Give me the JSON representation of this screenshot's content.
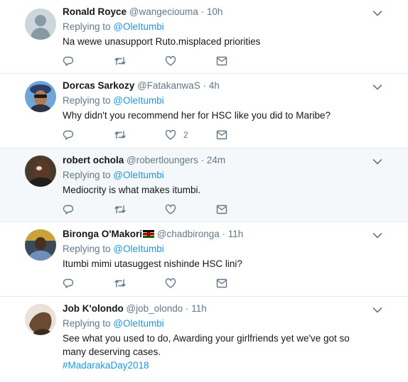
{
  "tweets": [
    {
      "name": "Ronald Royce",
      "handle": "@wangeciouma",
      "dot": "·",
      "time": "10h",
      "replying_prefix": "Replying to ",
      "replying_to": "@OleItumbi",
      "text": "Na wewe unasupport Ruto.misplaced priorities",
      "like_count": ""
    },
    {
      "name": "Dorcas Sarkozy",
      "handle": "@FatakanwaS",
      "dot": "·",
      "time": "4h",
      "replying_prefix": "Replying to ",
      "replying_to": "@OleItumbi",
      "text": "Why didn't you recommend her for HSC like you did to Maribe?",
      "like_count": "2"
    },
    {
      "name": "robert ochola",
      "handle": "@robertloungers",
      "dot": "·",
      "time": "24m",
      "replying_prefix": "Replying to ",
      "replying_to": "@OleItumbi",
      "text": "Mediocrity is what makes itumbi.",
      "like_count": ""
    },
    {
      "name": "Bironga O'Makori",
      "handle": "@chadbironga",
      "dot": "·",
      "time": "11h",
      "replying_prefix": "Replying to ",
      "replying_to": "@OleItumbi",
      "text": "Itumbi mimi utasuggest nishinde HSC lini?",
      "like_count": ""
    },
    {
      "name": "Job K'olondo",
      "handle": "@job_olondo",
      "dot": "·",
      "time": "11h",
      "replying_prefix": "Replying to ",
      "replying_to": "@OleItumbi",
      "text": "See what you used to do, Awarding your girlfriends yet we've got so many deserving cases.",
      "hashtag": "#MadarakaDay2018",
      "like_count": ""
    }
  ],
  "colors": {
    "link": "#1b95e0",
    "muted": "#657786",
    "text": "#14171a",
    "highlight_bg": "#f5f8fa",
    "divider": "#e6ecf0"
  },
  "icons": [
    "reply-icon",
    "retweet-icon",
    "like-icon",
    "direct-message-icon",
    "chevron-down-icon",
    "kenya-flag-icon"
  ]
}
